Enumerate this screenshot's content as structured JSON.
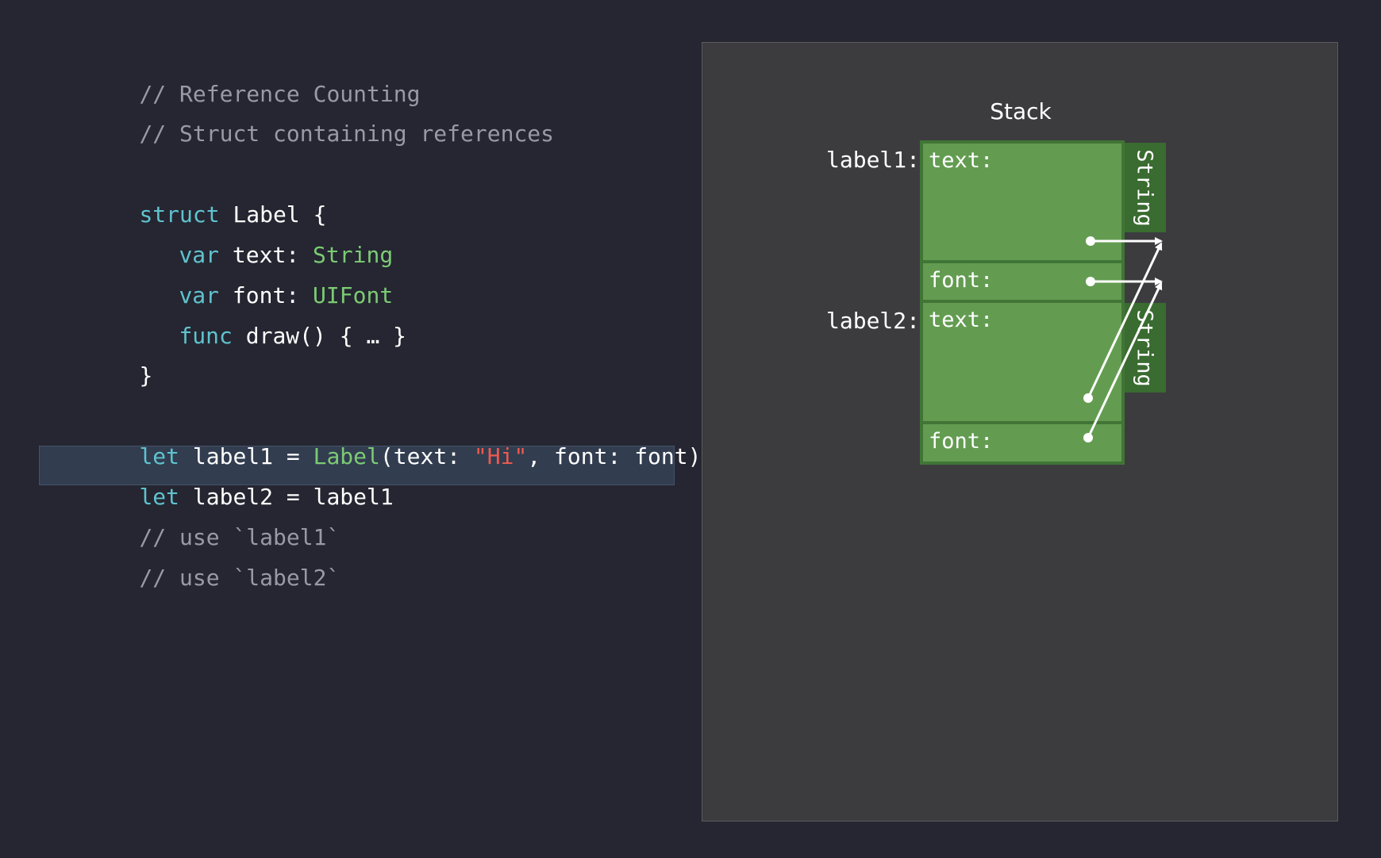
{
  "code": {
    "comment1": "// Reference Counting",
    "comment2": "// Struct containing references",
    "struct_kw": "struct",
    "struct_name": " Label {",
    "var_kw": "var",
    "text_decl": " text: ",
    "text_type": "String",
    "font_decl": " font: ",
    "font_type": "UIFont",
    "func_kw": "func",
    "func_rest": " draw() { … }",
    "close_brace": "}",
    "let_kw": "let",
    "let1_a": " label1 = ",
    "let1_type": "Label",
    "let1_b": "(text: ",
    "let1_string": "\"Hi\"",
    "let1_c": ", font: font)",
    "let2_rest": " label2 = label1",
    "use1": "// use `label1`",
    "use2": "// use `label2`"
  },
  "diagram": {
    "title": "Stack",
    "label1": "label1:",
    "label2": "label2:",
    "cells": [
      {
        "label": "text:"
      },
      {
        "label": "font:"
      },
      {
        "label": "text:"
      },
      {
        "label": "font:"
      }
    ],
    "side_tabs": [
      "String",
      "String"
    ]
  },
  "colors": {
    "background": "#252631",
    "diagram_bg": "#3c3c3f",
    "cell_fill": "#639c51",
    "cell_border": "#417536",
    "keyword": "#5fc3cf",
    "type": "#7ccb74",
    "string": "#ee5a4f",
    "comment": "#9a9aa6",
    "highlight": "#323d50"
  }
}
